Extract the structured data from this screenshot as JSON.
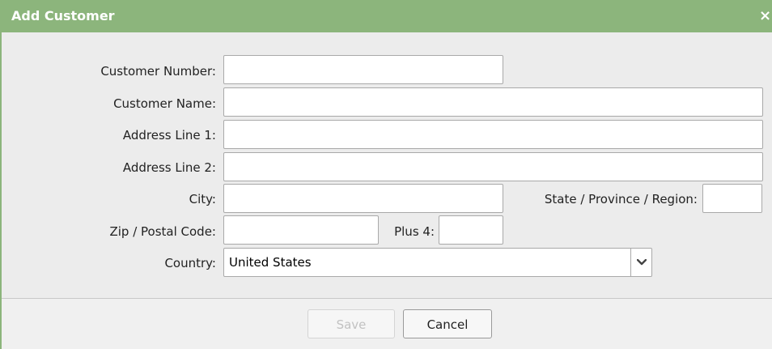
{
  "dialog": {
    "title": "Add Customer",
    "close_glyph": "×",
    "accent_color": "#8cb57c"
  },
  "form": {
    "customer_number": {
      "label": "Customer Number:",
      "value": ""
    },
    "customer_name": {
      "label": "Customer Name:",
      "value": ""
    },
    "address_line_1": {
      "label": "Address Line 1:",
      "value": ""
    },
    "address_line_2": {
      "label": "Address Line 2:",
      "value": ""
    },
    "city": {
      "label": "City:",
      "value": ""
    },
    "state": {
      "label": "State / Province / Region:",
      "value": ""
    },
    "zip": {
      "label": "Zip / Postal Code:",
      "value": ""
    },
    "plus4": {
      "label": "Plus 4:",
      "value": ""
    },
    "country": {
      "label": "Country:",
      "selected": "United States",
      "icon": "chevron-down-icon"
    }
  },
  "footer": {
    "save_label": "Save",
    "save_disabled": true,
    "cancel_label": "Cancel"
  }
}
